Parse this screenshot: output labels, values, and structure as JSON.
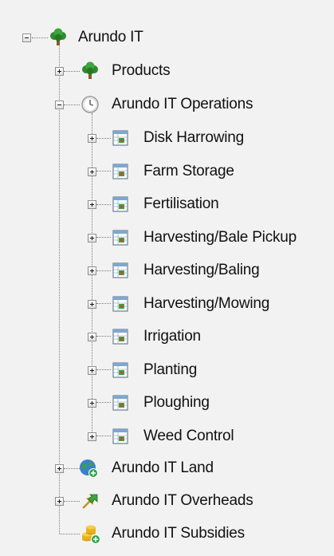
{
  "tree": {
    "root": {
      "label": "Arundo IT",
      "icon": "tree-icon",
      "expanded": true
    },
    "products": {
      "label": "Products",
      "icon": "tree-icon",
      "expanded": false
    },
    "operations": {
      "label": "Arundo IT Operations",
      "icon": "clock-icon",
      "expanded": true,
      "items": [
        {
          "label": "Disk Harrowing",
          "icon": "table-icon"
        },
        {
          "label": "Farm Storage",
          "icon": "table-icon"
        },
        {
          "label": "Fertilisation",
          "icon": "table-icon"
        },
        {
          "label": "Harvesting/Bale Pickup",
          "icon": "table-icon"
        },
        {
          "label": "Harvesting/Baling",
          "icon": "table-icon"
        },
        {
          "label": "Harvesting/Mowing",
          "icon": "table-icon"
        },
        {
          "label": "Irrigation",
          "icon": "table-icon"
        },
        {
          "label": "Planting",
          "icon": "table-icon"
        },
        {
          "label": "Ploughing",
          "icon": "table-icon"
        },
        {
          "label": "Weed Control",
          "icon": "table-icon"
        }
      ]
    },
    "land": {
      "label": "Arundo IT Land",
      "icon": "globe-add-icon",
      "expanded": false
    },
    "overheads": {
      "label": "Arundo IT Overheads",
      "icon": "arrows-icon",
      "expanded": false
    },
    "subsidies": {
      "label": "Arundo IT Subsidies",
      "icon": "coins-add-icon"
    }
  },
  "colors": {
    "background": "#f2f2f2",
    "text": "#111111",
    "tree_green": "#2e8b2e",
    "trunk_brown": "#8b5a2b",
    "connector": "#7a7a7a"
  }
}
